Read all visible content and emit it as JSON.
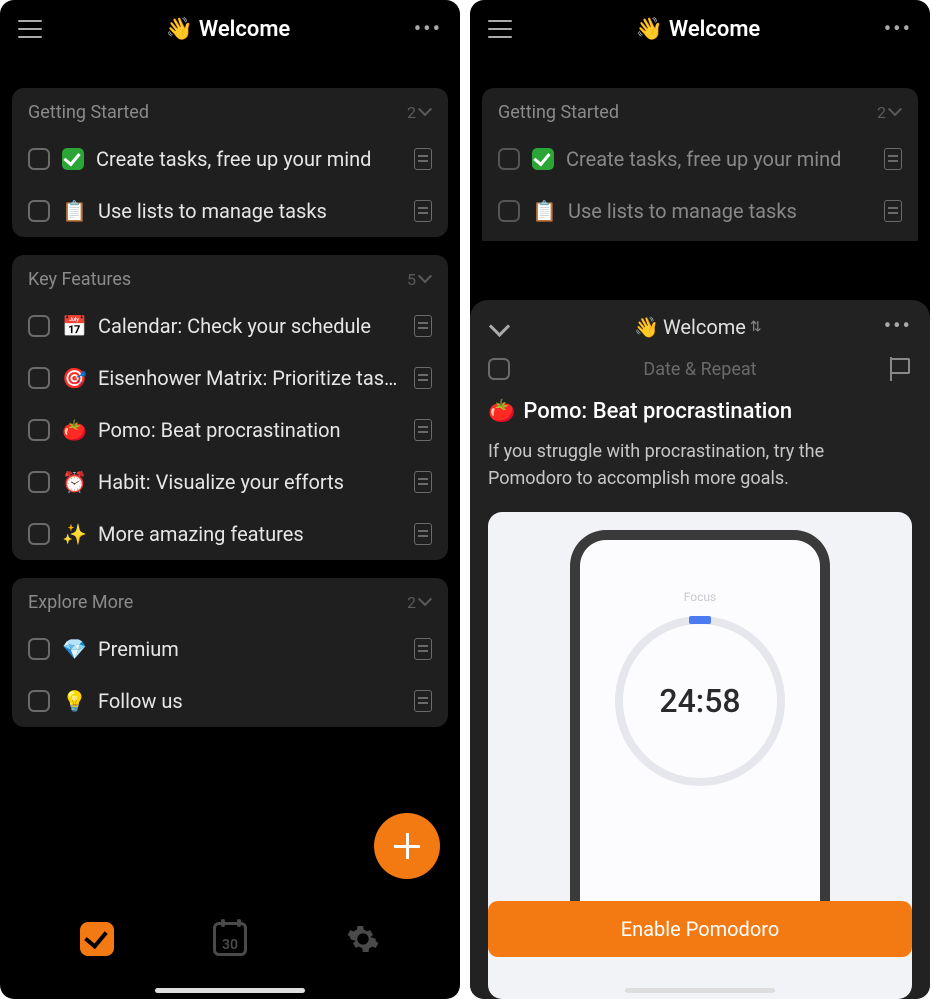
{
  "left": {
    "header": {
      "emoji": "👋",
      "title": "Welcome"
    },
    "sections": [
      {
        "title": "Getting Started",
        "count": "2",
        "items": [
          {
            "emoji": "check",
            "text": "Create tasks, free up your mind"
          },
          {
            "emoji": "📋",
            "text": "Use lists to manage tasks"
          }
        ]
      },
      {
        "title": "Key Features",
        "count": "5",
        "items": [
          {
            "emoji": "📅",
            "text": "Calendar: Check your schedule"
          },
          {
            "emoji": "🎯",
            "text": "Eisenhower Matrix: Prioritize tasks"
          },
          {
            "emoji": "🍅",
            "text": "Pomo: Beat procrastination"
          },
          {
            "emoji": "⏰",
            "text": "Habit: Visualize your efforts"
          },
          {
            "emoji": "✨",
            "text": "More amazing features"
          }
        ]
      },
      {
        "title": "Explore More",
        "count": "2",
        "items": [
          {
            "emoji": "💎",
            "text": "Premium"
          },
          {
            "emoji": "💡",
            "text": "Follow us"
          }
        ]
      }
    ],
    "tab_calendar_day": "30"
  },
  "right": {
    "header": {
      "emoji": "👋",
      "title": "Welcome"
    },
    "section": {
      "title": "Getting Started",
      "count": "2",
      "items": [
        {
          "emoji": "check",
          "text": "Create tasks, free up your mind"
        },
        {
          "emoji": "📋",
          "text": "Use lists to manage tasks"
        }
      ]
    },
    "detail": {
      "breadcrumb_emoji": "👋",
      "breadcrumb_title": "Welcome",
      "date_repeat_label": "Date & Repeat",
      "heading_emoji": "🍅",
      "heading_text": "Pomo: Beat procrastination",
      "description": "If you struggle with procrastination, try the Pomodoro to accomplish more goals.",
      "focus_label": "Focus",
      "timer_value": "24:58",
      "enable_button": "Enable Pomodoro"
    }
  }
}
